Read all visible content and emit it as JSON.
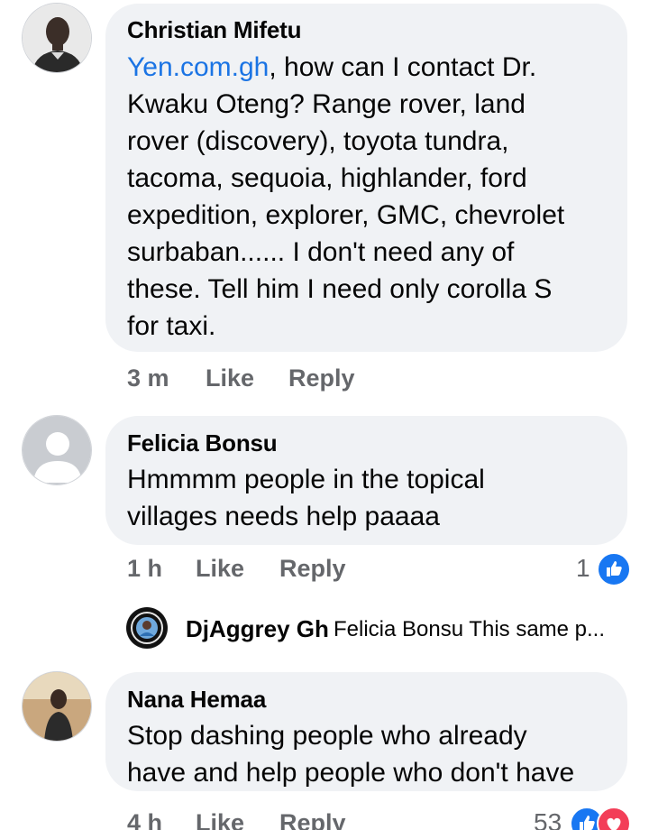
{
  "comments": [
    {
      "author": "Christian Mifetu",
      "link_text": "Yen.com.gh",
      "text": ", how can I contact Dr.\nKwaku Oteng? Range rover, land\nrover (discovery), toyota tundra,\ntacoma, sequoia, highlander, ford\nexpedition, explorer, GMC, chevrolet\nsurbaban...... I don't need any of\nthese. Tell him I need only corolla S\nfor taxi.",
      "time": "3 m",
      "like_label": "Like",
      "reply_label": "Reply"
    },
    {
      "author": "Felicia Bonsu",
      "text": "Hmmmm people in the topical\nvillages needs help paaaa",
      "time": "1 h",
      "like_label": "Like",
      "reply_label": "Reply",
      "reaction_count": "1",
      "reactions": [
        "like-icon"
      ]
    },
    {
      "author": "Nana Hemaa",
      "text": "Stop dashing people who already\nhave and help people who don't have",
      "time": "4 h",
      "like_label": "Like",
      "reply_label": "Reply",
      "reaction_count": "53",
      "reactions": [
        "like-icon",
        "love-icon"
      ]
    }
  ],
  "reply_preview": {
    "author": "DjAggrey Gh",
    "snippet": "Felicia Bonsu This same p..."
  },
  "colors": {
    "link": "#1b74e4",
    "like_blue": "#1877f2",
    "love_red": "#f33e58",
    "bubble": "#f0f2f5",
    "meta_gray": "#65676b"
  }
}
